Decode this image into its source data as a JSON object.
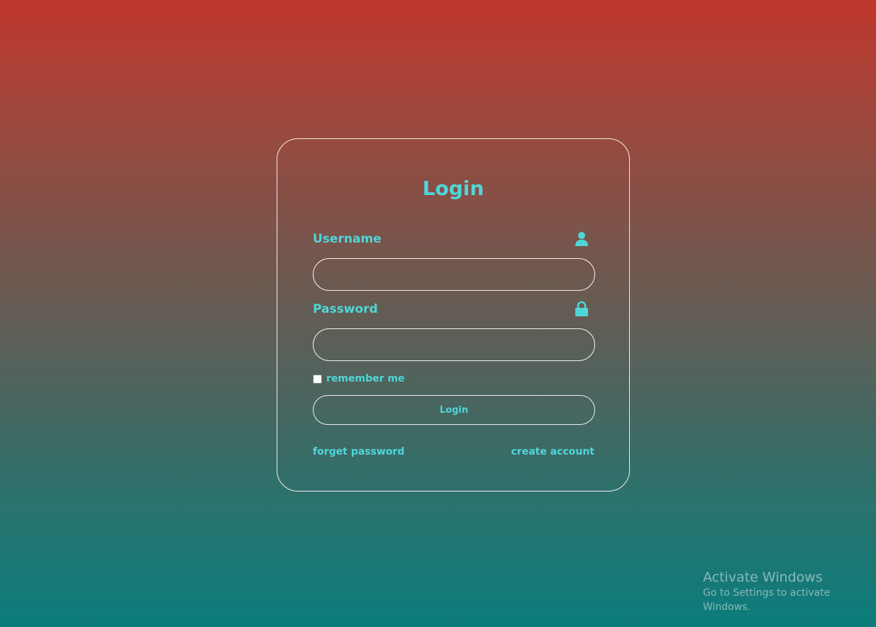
{
  "login_form": {
    "title": "Login",
    "username": {
      "label": "Username",
      "icon": "user-icon",
      "value": "",
      "placeholder": ""
    },
    "password": {
      "label": "Password",
      "icon": "lock-icon",
      "value": "",
      "placeholder": ""
    },
    "remember_me": {
      "label": "remember me",
      "checked": false
    },
    "submit_label": "Login",
    "forgot_link": "forget password",
    "create_link": "create account"
  },
  "watermark": {
    "title": "Activate Windows",
    "subtitle": "Go to Settings to activate Windows."
  },
  "colors": {
    "accent": "#4fd6d9",
    "border": "#f2eeee",
    "gradient_top": "#c0372e",
    "gradient_bottom": "#0b7c7b"
  }
}
